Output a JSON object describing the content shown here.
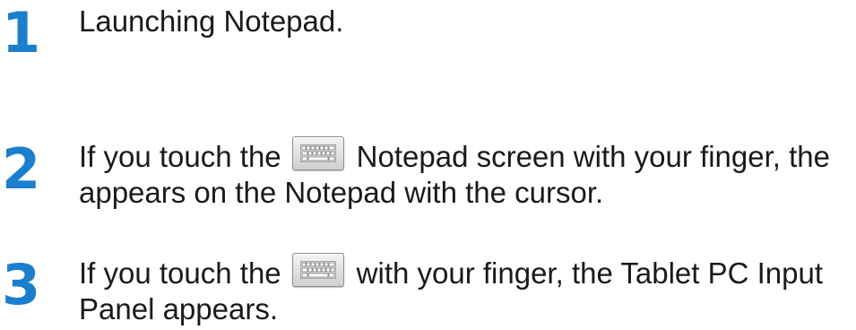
{
  "steps": [
    {
      "number": "1",
      "text": "Launching Notepad."
    },
    {
      "number": "2",
      "line1_before": "If you touch the",
      "icon": "keyboard-icon",
      "line1_after": "Notepad screen with your finger, the",
      "line2": "appears on the Notepad with the cursor."
    },
    {
      "number": "3",
      "line1_before": "If you touch the",
      "icon": "keyboard-icon",
      "line1_after": "with your finger, the Tablet PC Input",
      "line2": "Panel appears."
    }
  ],
  "colors": {
    "step_number": "#1b7fd0",
    "body_text": "#1a1a1a"
  }
}
